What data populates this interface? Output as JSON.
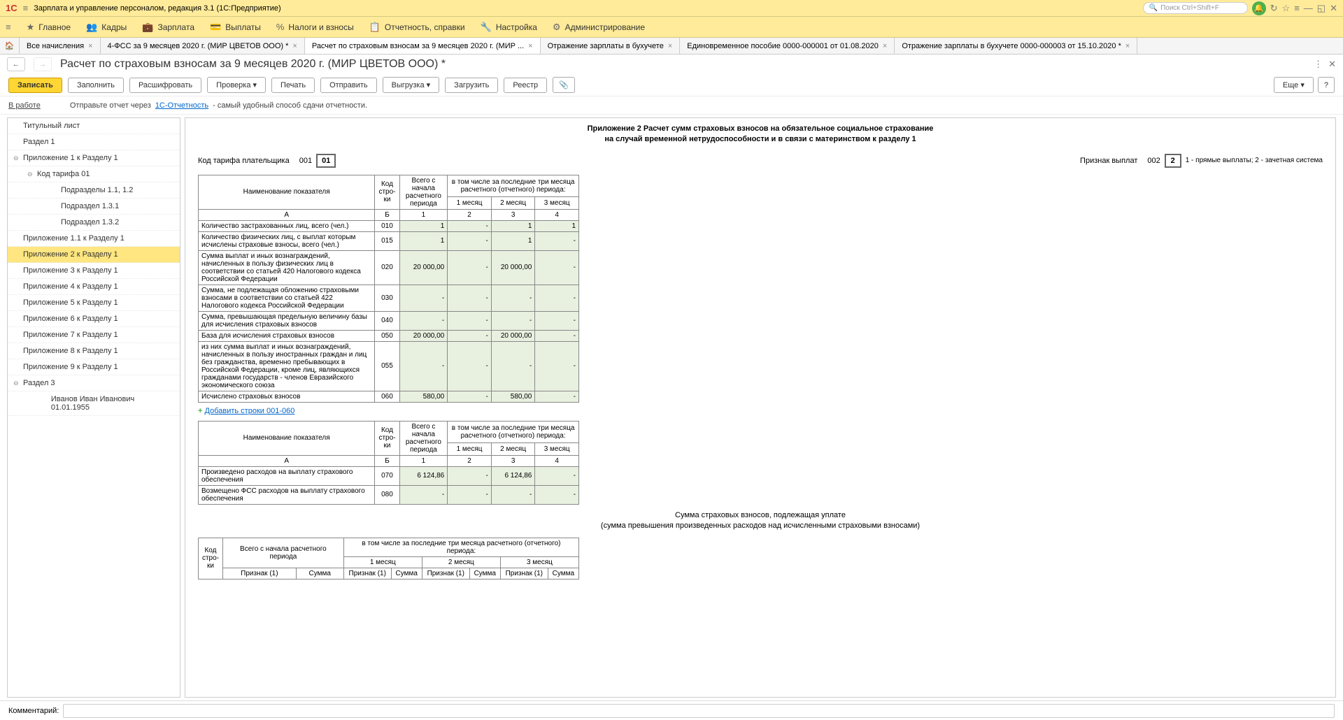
{
  "titlebar": {
    "app_title": "Зарплата и управление персоналом, редакция 3.1  (1С:Предприятие)",
    "search_placeholder": "Поиск Ctrl+Shift+F"
  },
  "mainmenu": [
    {
      "icon": "★",
      "label": "Главное"
    },
    {
      "icon": "👥",
      "label": "Кадры"
    },
    {
      "icon": "💼",
      "label": "Зарплата"
    },
    {
      "icon": "💳",
      "label": "Выплаты"
    },
    {
      "icon": "%",
      "label": "Налоги и взносы"
    },
    {
      "icon": "📋",
      "label": "Отчетность, справки"
    },
    {
      "icon": "🔧",
      "label": "Настройка"
    },
    {
      "icon": "⚙",
      "label": "Администрирование"
    }
  ],
  "tabs": [
    {
      "label": "Все начисления",
      "close": true
    },
    {
      "label": "4-ФСС за 9 месяцев 2020 г. (МИР ЦВЕТОВ ООО) *",
      "close": true
    },
    {
      "label": "Расчет по страховым взносам за 9 месяцев 2020 г. (МИР ...",
      "close": true,
      "active": true
    },
    {
      "label": "Отражение зарплаты в бухучете",
      "close": true
    },
    {
      "label": "Единовременное пособие 0000-000001 от 01.08.2020",
      "close": true
    },
    {
      "label": "Отражение зарплаты в бухучете 0000-000003 от 15.10.2020 *",
      "close": true
    }
  ],
  "page_title": "Расчет по страховым взносам за 9 месяцев 2020 г. (МИР ЦВЕТОВ ООО) *",
  "toolbar": {
    "save": "Записать",
    "fill": "Заполнить",
    "decode": "Расшифровать",
    "check": "Проверка",
    "print": "Печать",
    "send": "Отправить",
    "export": "Выгрузка",
    "load": "Загрузить",
    "registry": "Реестр",
    "more": "Еще"
  },
  "statusbar": {
    "status": "В работе",
    "text1": "Отправьте отчет через",
    "link": "1С-Отчетность",
    "text2": "- самый удобный способ сдачи отчетности."
  },
  "tree": [
    {
      "label": "Титульный лист",
      "indent": 0
    },
    {
      "label": "Раздел 1",
      "indent": 0
    },
    {
      "label": "Приложение 1 к Разделу 1",
      "indent": 0,
      "expand": "⊖"
    },
    {
      "label": "Код тарифа 01",
      "indent": 1,
      "expand": "⊖"
    },
    {
      "label": "Подразделы 1.1, 1.2",
      "indent": 3
    },
    {
      "label": "Подраздел 1.3.1",
      "indent": 3
    },
    {
      "label": "Подраздел 1.3.2",
      "indent": 3
    },
    {
      "label": "Приложение 1.1 к Разделу 1",
      "indent": 0
    },
    {
      "label": "Приложение 2 к Разделу 1",
      "indent": 0,
      "active": true
    },
    {
      "label": "Приложение 3 к Разделу 1",
      "indent": 0
    },
    {
      "label": "Приложение 4 к Разделу 1",
      "indent": 0
    },
    {
      "label": "Приложение 5 к Разделу 1",
      "indent": 0
    },
    {
      "label": "Приложение 6 к Разделу 1",
      "indent": 0
    },
    {
      "label": "Приложение 7 к Разделу 1",
      "indent": 0
    },
    {
      "label": "Приложение 8 к Разделу 1",
      "indent": 0
    },
    {
      "label": "Приложение 9 к Разделу 1",
      "indent": 0
    },
    {
      "label": "Раздел 3",
      "indent": 0,
      "expand": "⊖"
    },
    {
      "label": "Иванов Иван Иванович 01.01.1955",
      "indent": 2
    }
  ],
  "report": {
    "title_l1": "Приложение 2 Расчет сумм страховых взносов на обязательное социальное страхование",
    "title_l2": "на случай временной нетрудоспособности и в связи с материнством к разделу 1",
    "tarif_label": "Код тарифа плательщика",
    "tarif_code": "001",
    "tarif_val": "01",
    "vyplat_label": "Признак выплат",
    "vyplat_code": "002",
    "vyplat_val": "2",
    "vyplat_hint": "1 - прямые выплаты; 2 - зачетная система",
    "header": {
      "name": "Наименование показателя",
      "code": "Код стро-ки",
      "total": "Всего с начала расчетного периода",
      "last3": "в том числе за последние три месяца расчетного (отчетного) периода:",
      "m1": "1 месяц",
      "m2": "2 месяц",
      "m3": "3 месяц"
    },
    "colnums": {
      "a": "А",
      "b": "Б",
      "c1": "1",
      "c2": "2",
      "c3": "3",
      "c4": "4"
    },
    "rows1": [
      {
        "name": "Количество застрахованных лиц, всего (чел.)",
        "code": "010",
        "total": "1",
        "m1": "-",
        "m2": "1",
        "m3": "1"
      },
      {
        "name": "Количество физических лиц, с выплат которым исчислены страховые взносы, всего (чел.)",
        "code": "015",
        "total": "1",
        "m1": "-",
        "m2": "1",
        "m3": "-"
      },
      {
        "name": "Сумма выплат и иных вознаграждений, начисленных в пользу физических лиц в соответствии со статьей 420 Налогового кодекса Российской Федерации",
        "code": "020",
        "total": "20 000,00",
        "m1": "-",
        "m2": "20 000,00",
        "m3": "-"
      },
      {
        "name": "Сумма, не подлежащая обложению страховыми взносами в соответствии со статьей 422 Налогового кодекса Российской Федерации",
        "code": "030",
        "total": "-",
        "m1": "-",
        "m2": "-",
        "m3": "-"
      },
      {
        "name": "Сумма, превышающая предельную величину базы для исчисления страховых взносов",
        "code": "040",
        "total": "-",
        "m1": "-",
        "m2": "-",
        "m3": "-"
      },
      {
        "name": "База для исчисления страховых взносов",
        "code": "050",
        "total": "20 000,00",
        "m1": "-",
        "m2": "20 000,00",
        "m3": "-"
      },
      {
        "name": "из них сумма выплат и иных вознаграждений, начисленных в пользу иностранных граждан и лиц без гражданства, временно пребывающих в Российской Федерации, кроме лиц, являющихся гражданами государств - членов Евразийского экономического союза",
        "code": "055",
        "total": "-",
        "m1": "-",
        "m2": "-",
        "m3": "-"
      },
      {
        "name": "Исчислено страховых взносов",
        "code": "060",
        "total": "580,00",
        "m1": "-",
        "m2": "580,00",
        "m3": "-"
      }
    ],
    "add_rows": "Добавить строки 001-060",
    "rows2": [
      {
        "name": "Произведено расходов на выплату страхового обеспечения",
        "code": "070",
        "total": "6 124,86",
        "m1": "-",
        "m2": "6 124,86",
        "m3": "-"
      },
      {
        "name": "Возмещено ФСС расходов на выплату страхового обеспечения",
        "code": "080",
        "total": "-",
        "m1": "-",
        "m2": "-",
        "m3": "-"
      }
    ],
    "section3": {
      "title_l1": "Сумма страховых взносов, подлежащая уплате",
      "title_l2": "(сумма превышения произведенных расходов над исчисленными страховыми взносами)",
      "h_code": "Код стро-ки",
      "h_total": "Всего с начала расчетного периода",
      "h_last3": "в том числе за последние три месяца расчетного (отчетного) периода:",
      "h_priznak": "Признак (1)",
      "h_summa": "Сумма"
    }
  },
  "comment_label": "Комментарий:"
}
